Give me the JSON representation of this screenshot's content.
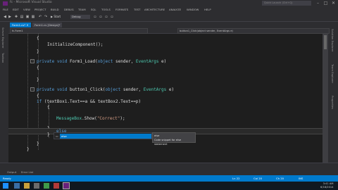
{
  "window": {
    "title": "fc - Microsoft Visual Studio",
    "quick_launch_placeholder": "Quick Launch (Ctrl+Q)"
  },
  "menu": [
    "FILE",
    "EDIT",
    "VIEW",
    "PROJECT",
    "BUILD",
    "DEBUG",
    "TEAM",
    "SQL",
    "TOOLS",
    "FORMATS",
    "TEST",
    "ARCHITECTURE",
    "ANALYZE",
    "WINDOW",
    "HELP"
  ],
  "toolbar": {
    "start_label": "▶ Start",
    "config": "Debug"
  },
  "left_tabs": [
    "Server Explorer",
    "Toolbox"
  ],
  "right_tabs": [
    "Solution Explorer",
    "Team Explorer",
    "Properties"
  ],
  "doc_tabs": [
    {
      "label": "Form1.cs*",
      "active": true
    },
    {
      "label": "Form1.cs [Design]*",
      "active": false
    }
  ],
  "nav": {
    "project": "fc.Form1",
    "member": "button1_Click(object sender, EventArgs e)"
  },
  "code": {
    "l1": "{",
    "l2_pre": "InitializeComponent();",
    "l3": "}",
    "l4_kw": "private void",
    "l4_name": " Form1_Load(",
    "l4_kw2": "object",
    "l4_mid": " sender, ",
    "l4_type": "EventArgs",
    "l4_end": " e)",
    "l5": "{",
    "l6": "}",
    "l7_kw": "private void",
    "l7_name": " button1_Click(",
    "l7_kw2": "object",
    "l7_mid": " sender, ",
    "l7_type": "EventArgs",
    "l7_end": " e)",
    "l8": "{",
    "l9_kw": "if",
    "l9_rest": " (textBox1.Text==a && textBox2.Text==p)",
    "l10": "{",
    "l11_type": "MessageBox",
    "l11_mid": ".Show(",
    "l11_str": "\"Correct\"",
    "l11_end": ");",
    "l12": "}",
    "l13_kw": "else",
    "l14": "}",
    "l15": "}",
    "l16": "}"
  },
  "intellisense": {
    "selected": "else",
    "tooltip_title": "else",
    "tooltip_desc": "Code snippet for else statement"
  },
  "bottom_tabs": [
    "Output",
    "Error List"
  ],
  "status": {
    "ready": "Ready",
    "ln": "Ln 22",
    "col": "Col 20",
    "ch": "Ch 20",
    "ins": "INS"
  },
  "taskbar": {
    "time": "3:41 AM",
    "date": "6/18/2014"
  },
  "colors": {
    "accent": "#007acc",
    "editor_bg": "#1e1e1e",
    "keyword": "#569cd6",
    "type": "#4ec9b0",
    "string": "#d69d85"
  }
}
